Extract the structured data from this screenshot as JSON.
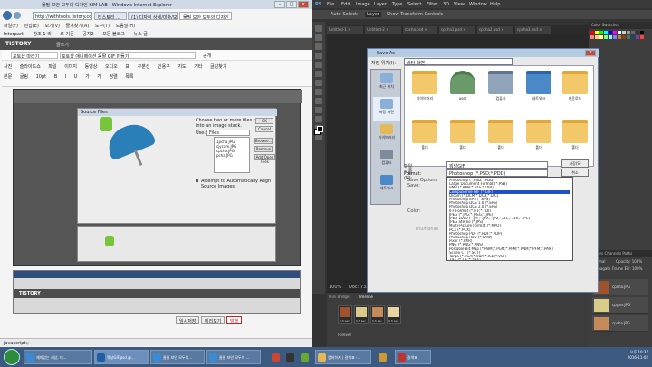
{
  "ie": {
    "title": "물필 보안 모두의 디자인 KIM LAB - Windows Internet Explorer",
    "address": "http://withtools.tistory.com",
    "tabs": [
      "티스토리 ...",
      "(1) 디자이 상세/미술/모...",
      "물필 보안 모두의 디자인 ..."
    ],
    "menu": [
      "파일(F)",
      "편집(E)",
      "보기(V)",
      "즐겨찾기(A)",
      "도구(T)",
      "도움말(H)"
    ],
    "favbar": [
      "Interpark",
      "참조 1 리",
      "로 기존",
      "공지2",
      "모든 블로그",
      "뉴스 글"
    ],
    "tistory_logo": "TISTORY",
    "tistory_sub": "글쓰기",
    "category": "포토샵 따라기",
    "post_title": "포토샵 애니메이션 움짤 GIF 만들기",
    "public_label": "공개",
    "toolbar_row1": [
      "사진",
      "슬라이드쇼",
      "파일",
      "이미지",
      "동영상",
      "오디오",
      "표",
      "구분선",
      "인용구",
      "지도",
      "기타",
      "글감찾기"
    ],
    "toolbar_row2": [
      "본문",
      "굴림",
      "10pt",
      "B",
      "I",
      "U",
      "가",
      "가",
      "정렬",
      "목록"
    ],
    "status": "javascript:;",
    "bottom_buttons": [
      "임시저장",
      "미리보기",
      "발행"
    ]
  },
  "inner_dialog": {
    "title": "Source Files",
    "desc": "Choose two or more files to load into an image stack.",
    "use_label": "Use:",
    "use_value": "Files",
    "files": [
      "1pcha.JPG",
      "cjycam.JPG",
      "cpcha.JPG",
      "pcha.JPG"
    ],
    "buttons": [
      "Browse...",
      "Remove",
      "Add Open Files"
    ],
    "ok": "OK",
    "cancel": "Cancel",
    "checkbox": "Attempt to Automatically Align Source Images"
  },
  "ps": {
    "menu": [
      "PS",
      "File",
      "Edit",
      "Image",
      "Layer",
      "Type",
      "Select",
      "Filter",
      "3D",
      "View",
      "Window",
      "Help"
    ],
    "options": [
      "Auto-Select:",
      "Layer",
      "Show Transform Controls"
    ],
    "doc_tabs": [
      "Untitled-1 ×",
      "Untitled-2 ×",
      "cpcha.psd ×",
      "cpcha1.psd ×",
      "cpcha2.psd ×",
      "cpcha3.psd ×"
    ],
    "zoom": "100%",
    "doc_info": "Doc: 733.4K/2.99M",
    "timeline_tabs": [
      "Mini Bridge",
      "Timeline"
    ],
    "frames": [
      "0.5 sec.",
      "0.5 sec.",
      "0.5 sec.",
      "0.5 sec."
    ],
    "forever": "Forever",
    "panels": [
      "Color",
      "Swatches",
      "Layers",
      "Channels",
      "Paths"
    ],
    "layer_names": [
      "cpcha.JPG",
      "cpyan.JPG",
      "cpcha.JPG"
    ],
    "blend": "Normal",
    "opacity": "Opacity: 100%",
    "fill": "Fill: 100%",
    "propagate": "Propagate Frame 1",
    "swatch_colors": [
      "#ff0000",
      "#ffff00",
      "#00ff00",
      "#00ffff",
      "#0000ff",
      "#ff00ff",
      "#ffffff",
      "#cccccc",
      "#999999",
      "#666666",
      "#333333",
      "#000000",
      "#ff8080",
      "#ffcc80",
      "#ffff80",
      "#80ff80",
      "#80ffff",
      "#8080ff",
      "#c08040",
      "#804020",
      "#408040",
      "#204080",
      "#804080",
      "#ff4040"
    ]
  },
  "save_as": {
    "title": "Save As",
    "save_in_label": "저장 위치(I):",
    "save_in_value": "바탕 화면",
    "places": [
      "최근 위치",
      "바탕 화면",
      "라이브러리",
      "컴퓨터",
      "네트워크"
    ],
    "files_row1": [
      "라이브러리",
      "user",
      "컴퓨터",
      "네트워크",
      "다운로드"
    ],
    "files_row2": [
      "폴더",
      "폴더",
      "폴더",
      "폴더",
      "폴더"
    ],
    "filename_label": "파일 이름(N):",
    "filename_value": "뭐낭GIF",
    "format_label": "Format:",
    "format_value": "Photoshop (*.PSD;*.PDD)",
    "save_btn": "저장(S)",
    "cancel_btn": "취소",
    "save_options": "Save Options",
    "save_label": "Save:",
    "color_label": "Color:",
    "thumbnail": "Thumbnail",
    "format_options": [
      "Photoshop (*.PSD;*.PDD)",
      "Large Document Format (*.PSB)",
      "BMP (*.BMP;*.RLE;*.DIB)",
      "CompuServe GIF (*.GIF)",
      "Dicom (*.DCM;*.DC3;*.DIC)",
      "Photoshop EPS (*.EPS)",
      "Photoshop DCS 1.0 (*.EPS)",
      "Photoshop DCS 2.0 (*.EPS)",
      "IFF Format (*.IFF;*.TDI)",
      "JPEG (*.JPG;*.JPEG;*.JPE)",
      "JPEG 2000 (*.JPF;*.JPX;*.JP2;*.J2C;*.J2K;*.JPC)",
      "JPEG Stereo (*.JPS)",
      "Multi-Picture Format (*.MPO)",
      "PCX (*.PCX)",
      "Photoshop PDF (*.PDF;*.PDP)",
      "Photoshop Raw (*.RAW)",
      "Pixar (*.PXR)",
      "PNG (*.PNG;*.PNS)",
      "Portable Bit Map (*.PBM;*.PGM;*.PPM;*.PNM;*.PFM;*.PAM)",
      "Scitex CT (*.SCT)",
      "Targa (*.TGA;*.VDA;*.ICB;*.VST)",
      "TIFF (*.TIF;*.TIFF)"
    ],
    "selected_index": 3
  },
  "desktop_icons": [
    "다운로드",
    "바탕 화면",
    "최근 위치",
    "다운로",
    "라이브러리",
    "메그,캡쳐,편집",
    "everus 파일"
  ],
  "taskbar": {
    "items": [
      "재미있는 세상, 재...",
      "뭐낭GIF.psd @...",
      "물필 보안 모두의...",
      "물필 보안 모두의 ...",
      "캡처하기 | 갈색표 -...",
      "갈색표"
    ],
    "clock_time": "오후 10:37",
    "clock_date": "2016-11-02"
  }
}
